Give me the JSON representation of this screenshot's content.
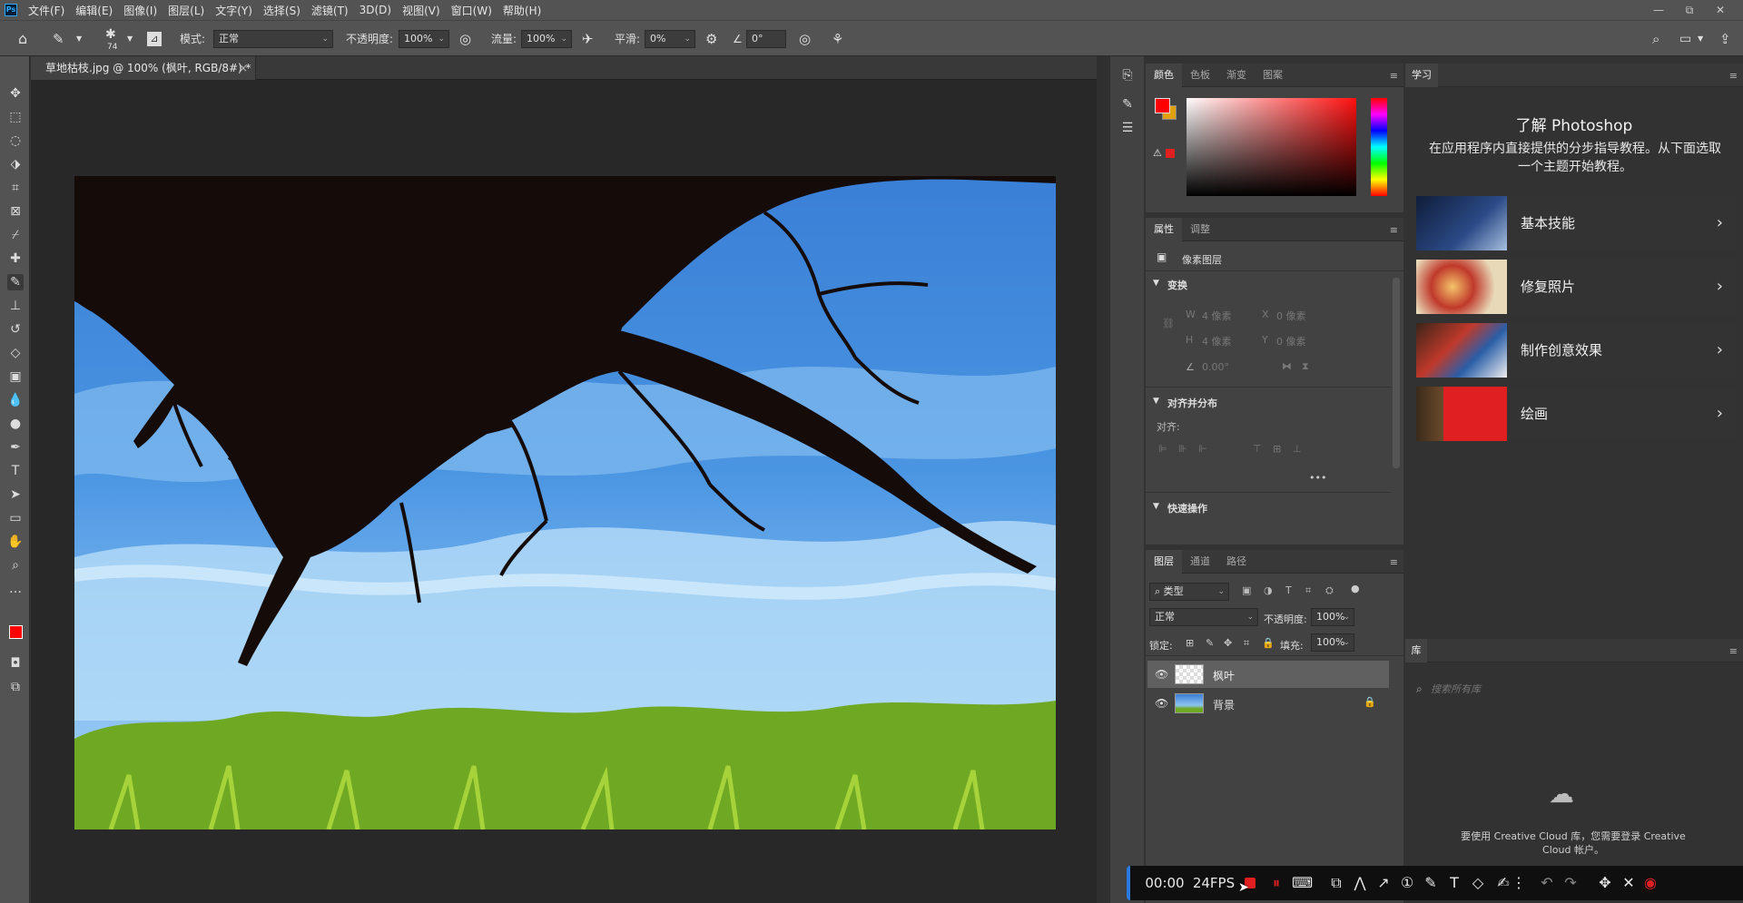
{
  "app": {
    "logo": "Ps",
    "menu": [
      "文件(F)",
      "编辑(E)",
      "图像(I)",
      "图层(L)",
      "文字(Y)",
      "选择(S)",
      "滤镜(T)",
      "3D(D)",
      "视图(V)",
      "窗口(W)",
      "帮助(H)"
    ],
    "win_controls": [
      "—",
      "⧉",
      "✕"
    ]
  },
  "options": {
    "brush_size": "74",
    "mode_label": "模式:",
    "mode_value": "正常",
    "opacity_label": "不透明度:",
    "opacity_value": "100%",
    "flow_label": "流量:",
    "flow_value": "100%",
    "smooth_label": "平滑:",
    "smooth_value": "0%",
    "angle_value": "0°"
  },
  "document": {
    "tab_title": "草地枯枝.jpg @ 100% (枫叶, RGB/8#) *",
    "tab_close": "×"
  },
  "color_panel": {
    "tabs": [
      "颜色",
      "色板",
      "渐变",
      "图案"
    ],
    "foreground": "#ff0000",
    "background": "#e0a010"
  },
  "properties_panel": {
    "tabs": [
      "属性",
      "调整"
    ],
    "layer_type": "像素图层",
    "transform_title": "变换",
    "w_label": "W",
    "w_value": "4 像素",
    "x_label": "X",
    "x_value": "0 像素",
    "h_label": "H",
    "h_value": "4 像素",
    "y_label": "Y",
    "y_value": "0 像素",
    "angle_value": "0.00°",
    "align_title": "对齐并分布",
    "align_label": "对齐:",
    "more": "•••",
    "quick_title": "快速操作"
  },
  "layers_panel": {
    "tabs": [
      "图层",
      "通道",
      "路径"
    ],
    "filter_label": "类型",
    "blend_mode": "正常",
    "opacity_label": "不透明度:",
    "opacity_value": "100%",
    "lock_label": "锁定:",
    "fill_label": "填充:",
    "fill_value": "100%",
    "layers": [
      {
        "name": "枫叶",
        "selected": true
      },
      {
        "name": "背景",
        "selected": false,
        "locked": true
      }
    ]
  },
  "learn_panel": {
    "tab": "学习",
    "title": "了解 Photoshop",
    "description": "在应用程序内直接提供的分步指导教程。从下面选取一个主题开始教程。",
    "cards": [
      {
        "label": "基本技能"
      },
      {
        "label": "修复照片"
      },
      {
        "label": "制作创意效果"
      },
      {
        "label": "绘画"
      }
    ]
  },
  "library_panel": {
    "tab": "库",
    "search_placeholder": "搜索所有库",
    "message": "要使用 Creative Cloud 库，您需要登录 Creative Cloud 帐户。"
  },
  "recorder": {
    "time": "00:00",
    "fps": "24FPS"
  }
}
